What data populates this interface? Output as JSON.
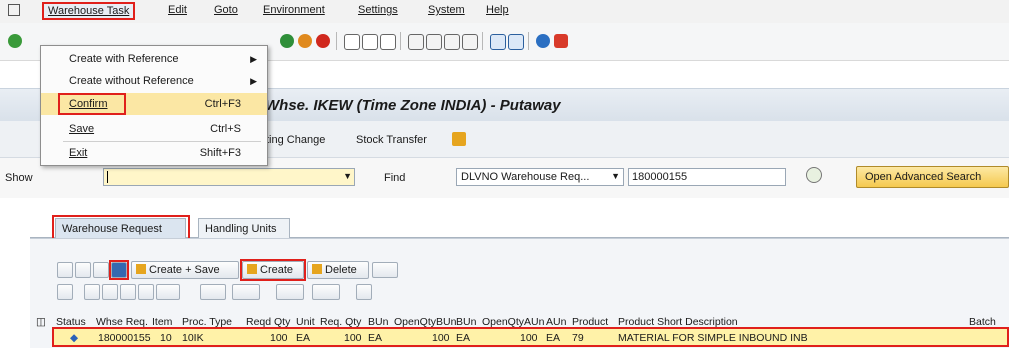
{
  "menubar": {
    "items": [
      {
        "label": "Warehouse Task"
      },
      {
        "label": "Edit"
      },
      {
        "label": "Goto"
      },
      {
        "label": "Environment"
      },
      {
        "label": "Settings"
      },
      {
        "label": "System"
      },
      {
        "label": "Help"
      }
    ]
  },
  "dropdown": {
    "items": [
      {
        "label": "Create with Reference",
        "shortcut": "",
        "submenu": true
      },
      {
        "label": "Create without Reference",
        "shortcut": "",
        "submenu": true
      },
      {
        "label": "Confirm",
        "shortcut": "Ctrl+F3",
        "submenu": false
      },
      {
        "label": "Save",
        "shortcut": "Ctrl+S",
        "submenu": false
      },
      {
        "label": "Exit",
        "shortcut": "Shift+F3",
        "submenu": false
      }
    ]
  },
  "window": {
    "title": "Whse. IKEW (Time Zone INDIA) - Putaway"
  },
  "apptoolbar": {
    "item1": "ting Change",
    "item2": "Stock Transfer"
  },
  "search": {
    "show_label": "Show",
    "find_label": "Find",
    "find_field_value": "DLVNO Warehouse Req...",
    "find_value": "180000155",
    "advanced_button": "Open Advanced Search"
  },
  "tabs": [
    {
      "label": "Warehouse Request"
    },
    {
      "label": "Handling Units"
    }
  ],
  "grid_toolbar": {
    "create_save": "Create + Save",
    "create": "Create",
    "delete": "Delete"
  },
  "table": {
    "columns": [
      "Status",
      "Whse Req.",
      "Item",
      "Proc. Type",
      "Reqd Qty",
      "Unit",
      "Req. Qty",
      "BUn",
      "OpenQtyBUn",
      "BUn",
      "OpenQtyAUn",
      "AUn",
      "Product",
      "Product Short Description",
      "Batch"
    ],
    "rows": [
      {
        "status_icon": "diamond-icon",
        "whse_req": "180000155",
        "item": "10",
        "proc_type": "10IK",
        "reqd_qty": "100",
        "unit": "EA",
        "req_qty": "100",
        "bun": "EA",
        "open_qty_bun": "100",
        "bun2": "EA",
        "open_qty_aun": "100",
        "aun": "EA",
        "product": "79",
        "description": "MATERIAL FOR SIMPLE INBOUND INB",
        "batch": ""
      }
    ]
  },
  "colors": {
    "highlight_red": "#e0201b",
    "selected_row": "#fff2a8",
    "button_gold": "#f5c94f",
    "menu_selected": "#fbe7a4"
  }
}
